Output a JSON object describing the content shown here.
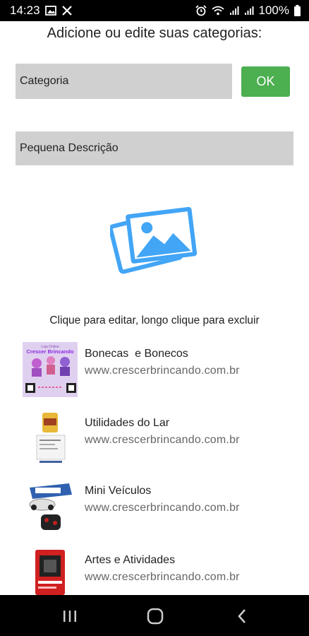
{
  "status_bar": {
    "time": "14:23",
    "battery": "100%",
    "left_icons": [
      "image-notification-icon",
      "tools-notification-icon"
    ],
    "right_icons": [
      "alarm-icon",
      "wifi-icon",
      "signal-icon",
      "signal-icon",
      "battery-icon"
    ]
  },
  "heading": "Adicione ou edite suas categorias:",
  "form": {
    "category_placeholder": "Categoria",
    "ok_label": "OK",
    "description_placeholder": "Pequena Descrição",
    "image_picker_icon": "image-gallery-icon"
  },
  "hint": "Clique para editar, longo clique para excluir",
  "categories": [
    {
      "title": "Bonecas  e Bonecos",
      "subtitle": "www.crescerbrincando.com.br",
      "thumb_text": "Crescer Brincando"
    },
    {
      "title": "Utilidades do Lar",
      "subtitle": "www.crescerbrincando.com.br"
    },
    {
      "title": "Mini Veículos",
      "subtitle": "www.crescerbrincando.com.br"
    },
    {
      "title": "Artes e Atividades",
      "subtitle": "www.crescerbrincando.com.br"
    }
  ],
  "colors": {
    "accent_blue": "#42a5f5",
    "ok_green": "#4caf50",
    "field_gray": "#d0d0d0"
  },
  "nav_bar": {
    "icons": [
      "recent-apps-icon",
      "home-icon",
      "back-icon"
    ]
  }
}
